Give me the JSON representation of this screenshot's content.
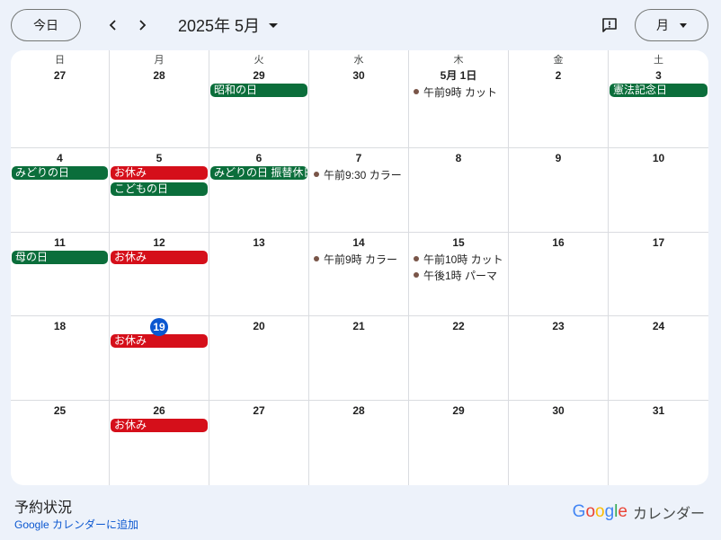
{
  "toolbar": {
    "today_label": "今日",
    "month_title": "2025年 5月",
    "view_label": "月",
    "prev_icon": "chevron-left-icon",
    "next_icon": "chevron-right-icon",
    "feedback_icon": "feedback-icon"
  },
  "colors": {
    "holiday": "#0b6e3b",
    "closed": "#d50f1a",
    "appointment_dot": "#795548",
    "today": "#0b57d0"
  },
  "weekdays": [
    "日",
    "月",
    "火",
    "水",
    "木",
    "金",
    "土"
  ],
  "weeks": [
    [
      {
        "day": "27",
        "events": []
      },
      {
        "day": "28",
        "events": []
      },
      {
        "day": "29",
        "events": [
          {
            "kind": "chip",
            "color": "green",
            "label": "昭和の日"
          }
        ]
      },
      {
        "day": "30",
        "events": []
      },
      {
        "day": "5月 1日",
        "events": [
          {
            "kind": "timed",
            "label": "午前9時 カット"
          }
        ]
      },
      {
        "day": "2",
        "events": []
      },
      {
        "day": "3",
        "events": [
          {
            "kind": "chip",
            "color": "green",
            "label": "憲法記念日"
          }
        ]
      }
    ],
    [
      {
        "day": "4",
        "events": [
          {
            "kind": "chip",
            "color": "green",
            "label": "みどりの日"
          }
        ]
      },
      {
        "day": "5",
        "events": [
          {
            "kind": "chip",
            "color": "red",
            "label": "お休み"
          },
          {
            "kind": "chip",
            "color": "green",
            "label": "こどもの日"
          }
        ]
      },
      {
        "day": "6",
        "events": [
          {
            "kind": "chip",
            "color": "green",
            "label": "みどりの日 振替休日"
          }
        ]
      },
      {
        "day": "7",
        "events": [
          {
            "kind": "timed",
            "label": "午前9:30 カラー"
          }
        ]
      },
      {
        "day": "8",
        "events": []
      },
      {
        "day": "9",
        "events": []
      },
      {
        "day": "10",
        "events": []
      }
    ],
    [
      {
        "day": "11",
        "events": [
          {
            "kind": "chip",
            "color": "green",
            "label": "母の日"
          }
        ]
      },
      {
        "day": "12",
        "events": [
          {
            "kind": "chip",
            "color": "red",
            "label": "お休み"
          }
        ]
      },
      {
        "day": "13",
        "events": []
      },
      {
        "day": "14",
        "events": [
          {
            "kind": "timed",
            "label": "午前9時 カラー"
          }
        ]
      },
      {
        "day": "15",
        "events": [
          {
            "kind": "timed",
            "label": "午前10時 カット"
          },
          {
            "kind": "timed",
            "label": "午後1時 パーマ"
          }
        ]
      },
      {
        "day": "16",
        "events": []
      },
      {
        "day": "17",
        "events": []
      }
    ],
    [
      {
        "day": "18",
        "events": []
      },
      {
        "day": "19",
        "today": true,
        "events": [
          {
            "kind": "chip",
            "color": "red",
            "label": "お休み"
          }
        ]
      },
      {
        "day": "20",
        "events": []
      },
      {
        "day": "21",
        "events": []
      },
      {
        "day": "22",
        "events": []
      },
      {
        "day": "23",
        "events": []
      },
      {
        "day": "24",
        "events": []
      }
    ],
    [
      {
        "day": "25",
        "events": []
      },
      {
        "day": "26",
        "events": [
          {
            "kind": "chip",
            "color": "red",
            "label": "お休み"
          }
        ]
      },
      {
        "day": "27",
        "events": []
      },
      {
        "day": "28",
        "events": []
      },
      {
        "day": "29",
        "events": []
      },
      {
        "day": "30",
        "events": []
      },
      {
        "day": "31",
        "events": []
      }
    ]
  ],
  "footer": {
    "title": "予約状況",
    "add_link": "Google カレンダーに追加",
    "brand_google": "Google",
    "brand_suffix": "カレンダー"
  }
}
